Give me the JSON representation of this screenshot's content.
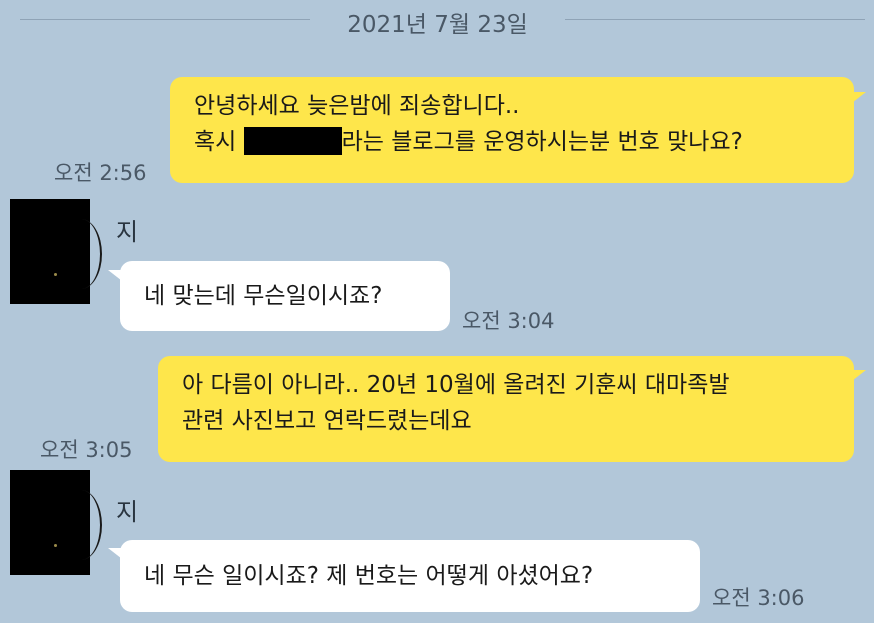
{
  "date_separator": "2021년 7월 23일",
  "sender_name": "지",
  "messages": [
    {
      "from": "me",
      "line1": "안녕하세요 늦은밤에 죄송합니다..",
      "line2_before": "혹시 ",
      "line2_after": "라는 블로그를 운영하시는분 번호 맞나요?",
      "time": "오전 2:56"
    },
    {
      "from": "other",
      "text": "네 맞는데 무슨일이시죠?",
      "time": "오전 3:04"
    },
    {
      "from": "me",
      "line1": "아 다름이 아니라.. 20년 10월에 올려진 기훈씨 대마족발",
      "line2": "관련 사진보고 연락드렸는데요",
      "time": "오전 3:05"
    },
    {
      "from": "other",
      "text": "네 무슨 일이시죠? 제 번호는 어떻게 아셨어요?",
      "time": "오전 3:06"
    }
  ],
  "colors": {
    "background": "#b2c7d9",
    "my_bubble": "#fee64b",
    "other_bubble": "#ffffff"
  }
}
